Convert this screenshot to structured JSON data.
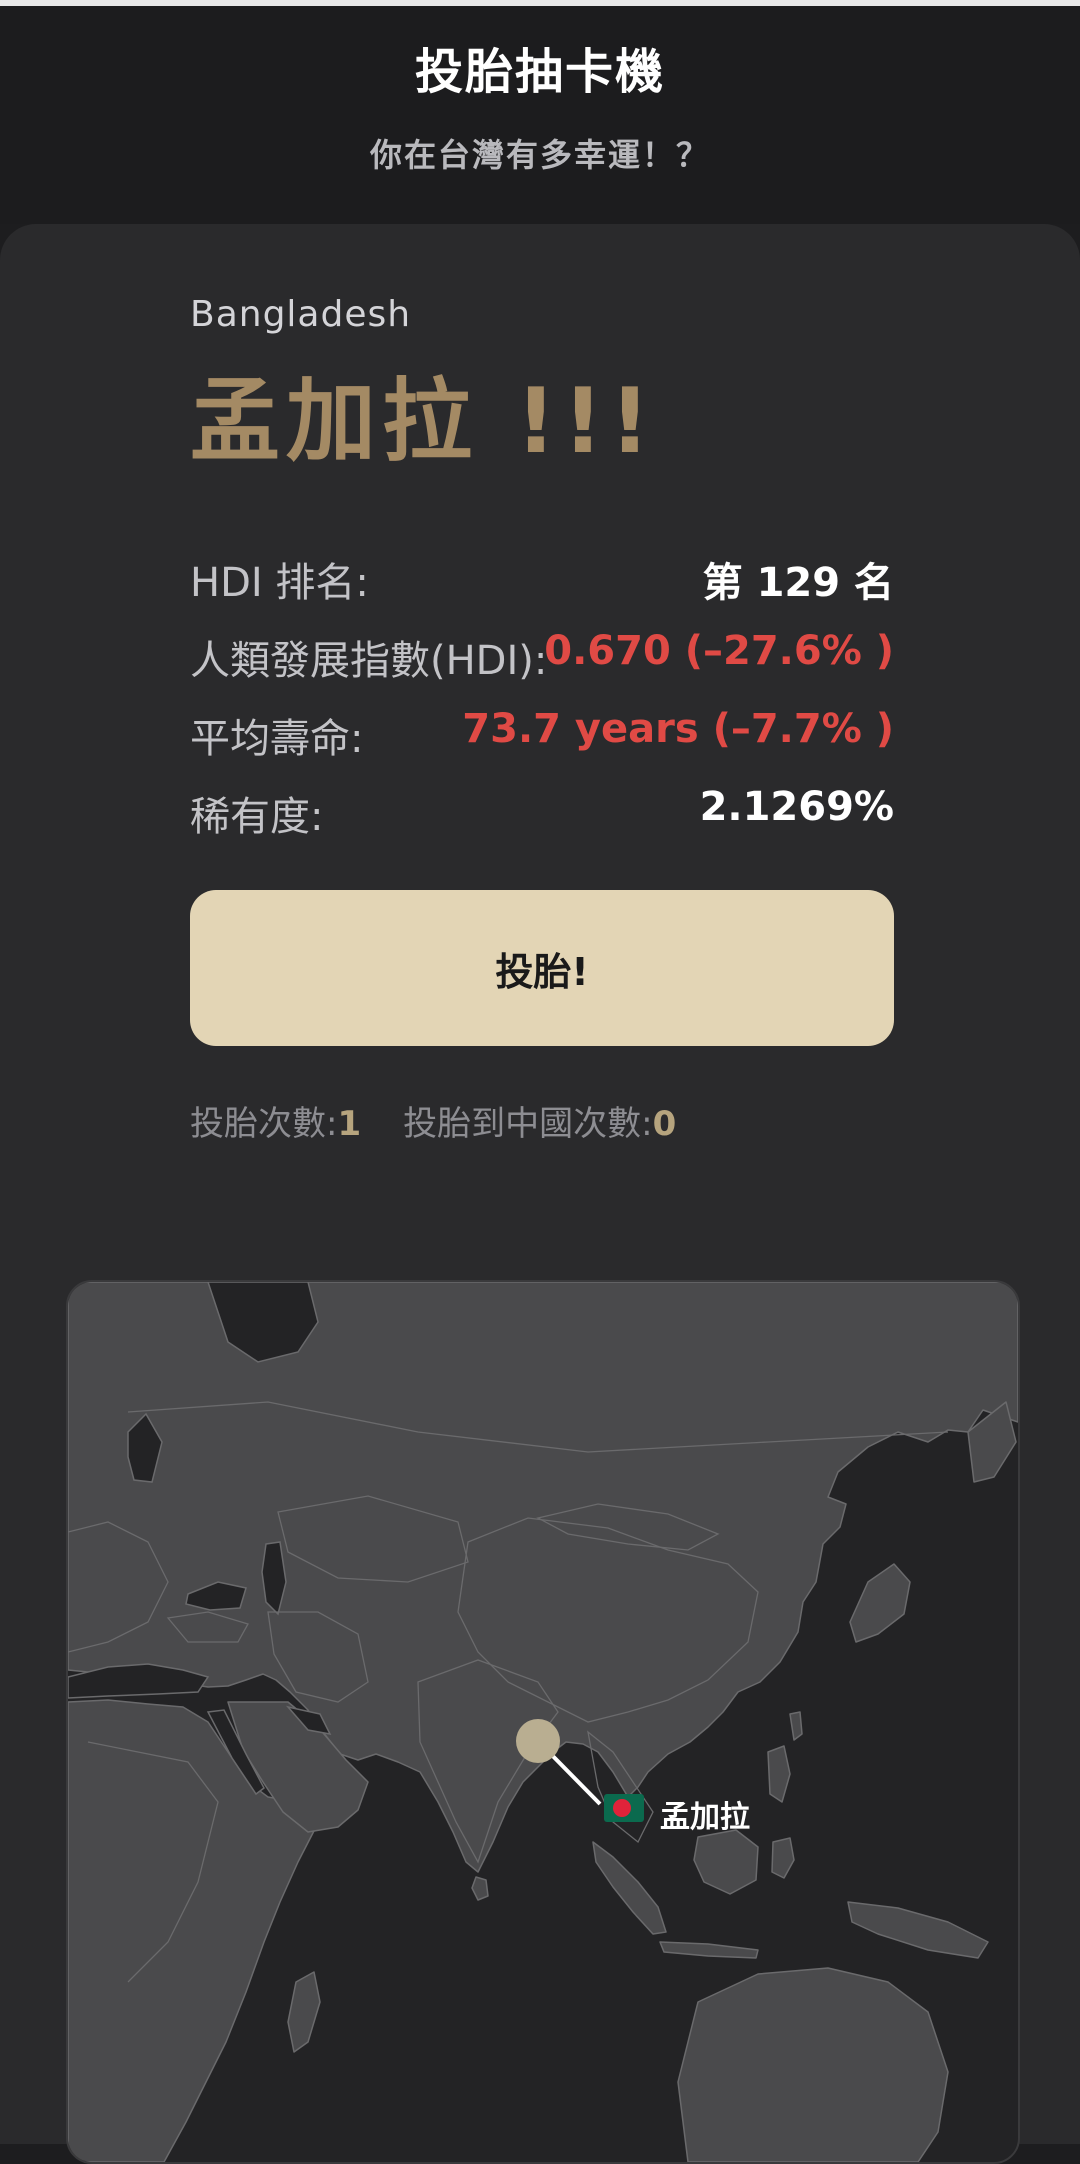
{
  "header": {
    "title": "投胎抽卡機",
    "subtitle": "你在台灣有多幸運！？"
  },
  "result": {
    "country_en": "Bangladesh",
    "country_zh": "孟加拉 !!!"
  },
  "stats": {
    "hdi_rank_label": "HDI 排名:",
    "hdi_rank_value": "第 129 名",
    "hdi_label": "人類發展指數(HDI):",
    "hdi_value": "0.670 (–27.6% )",
    "life_label": "平均壽命:",
    "life_value": "73.7 years (–7.7% )",
    "rarity_label": "稀有度:",
    "rarity_value": "2.1269%"
  },
  "actions": {
    "draw_button": "投胎!"
  },
  "counters": {
    "draws_label": "投胎次數:",
    "draws_value": "1",
    "china_label": "投胎到中國次數:",
    "china_value": "0"
  },
  "map": {
    "marker_label": "孟加拉",
    "land_color": "#4a4a4c",
    "sea_color": "#232325",
    "marker_color": "#b9ae91",
    "flag_green": "#0b6a4e",
    "flag_red": "#e0233a"
  }
}
